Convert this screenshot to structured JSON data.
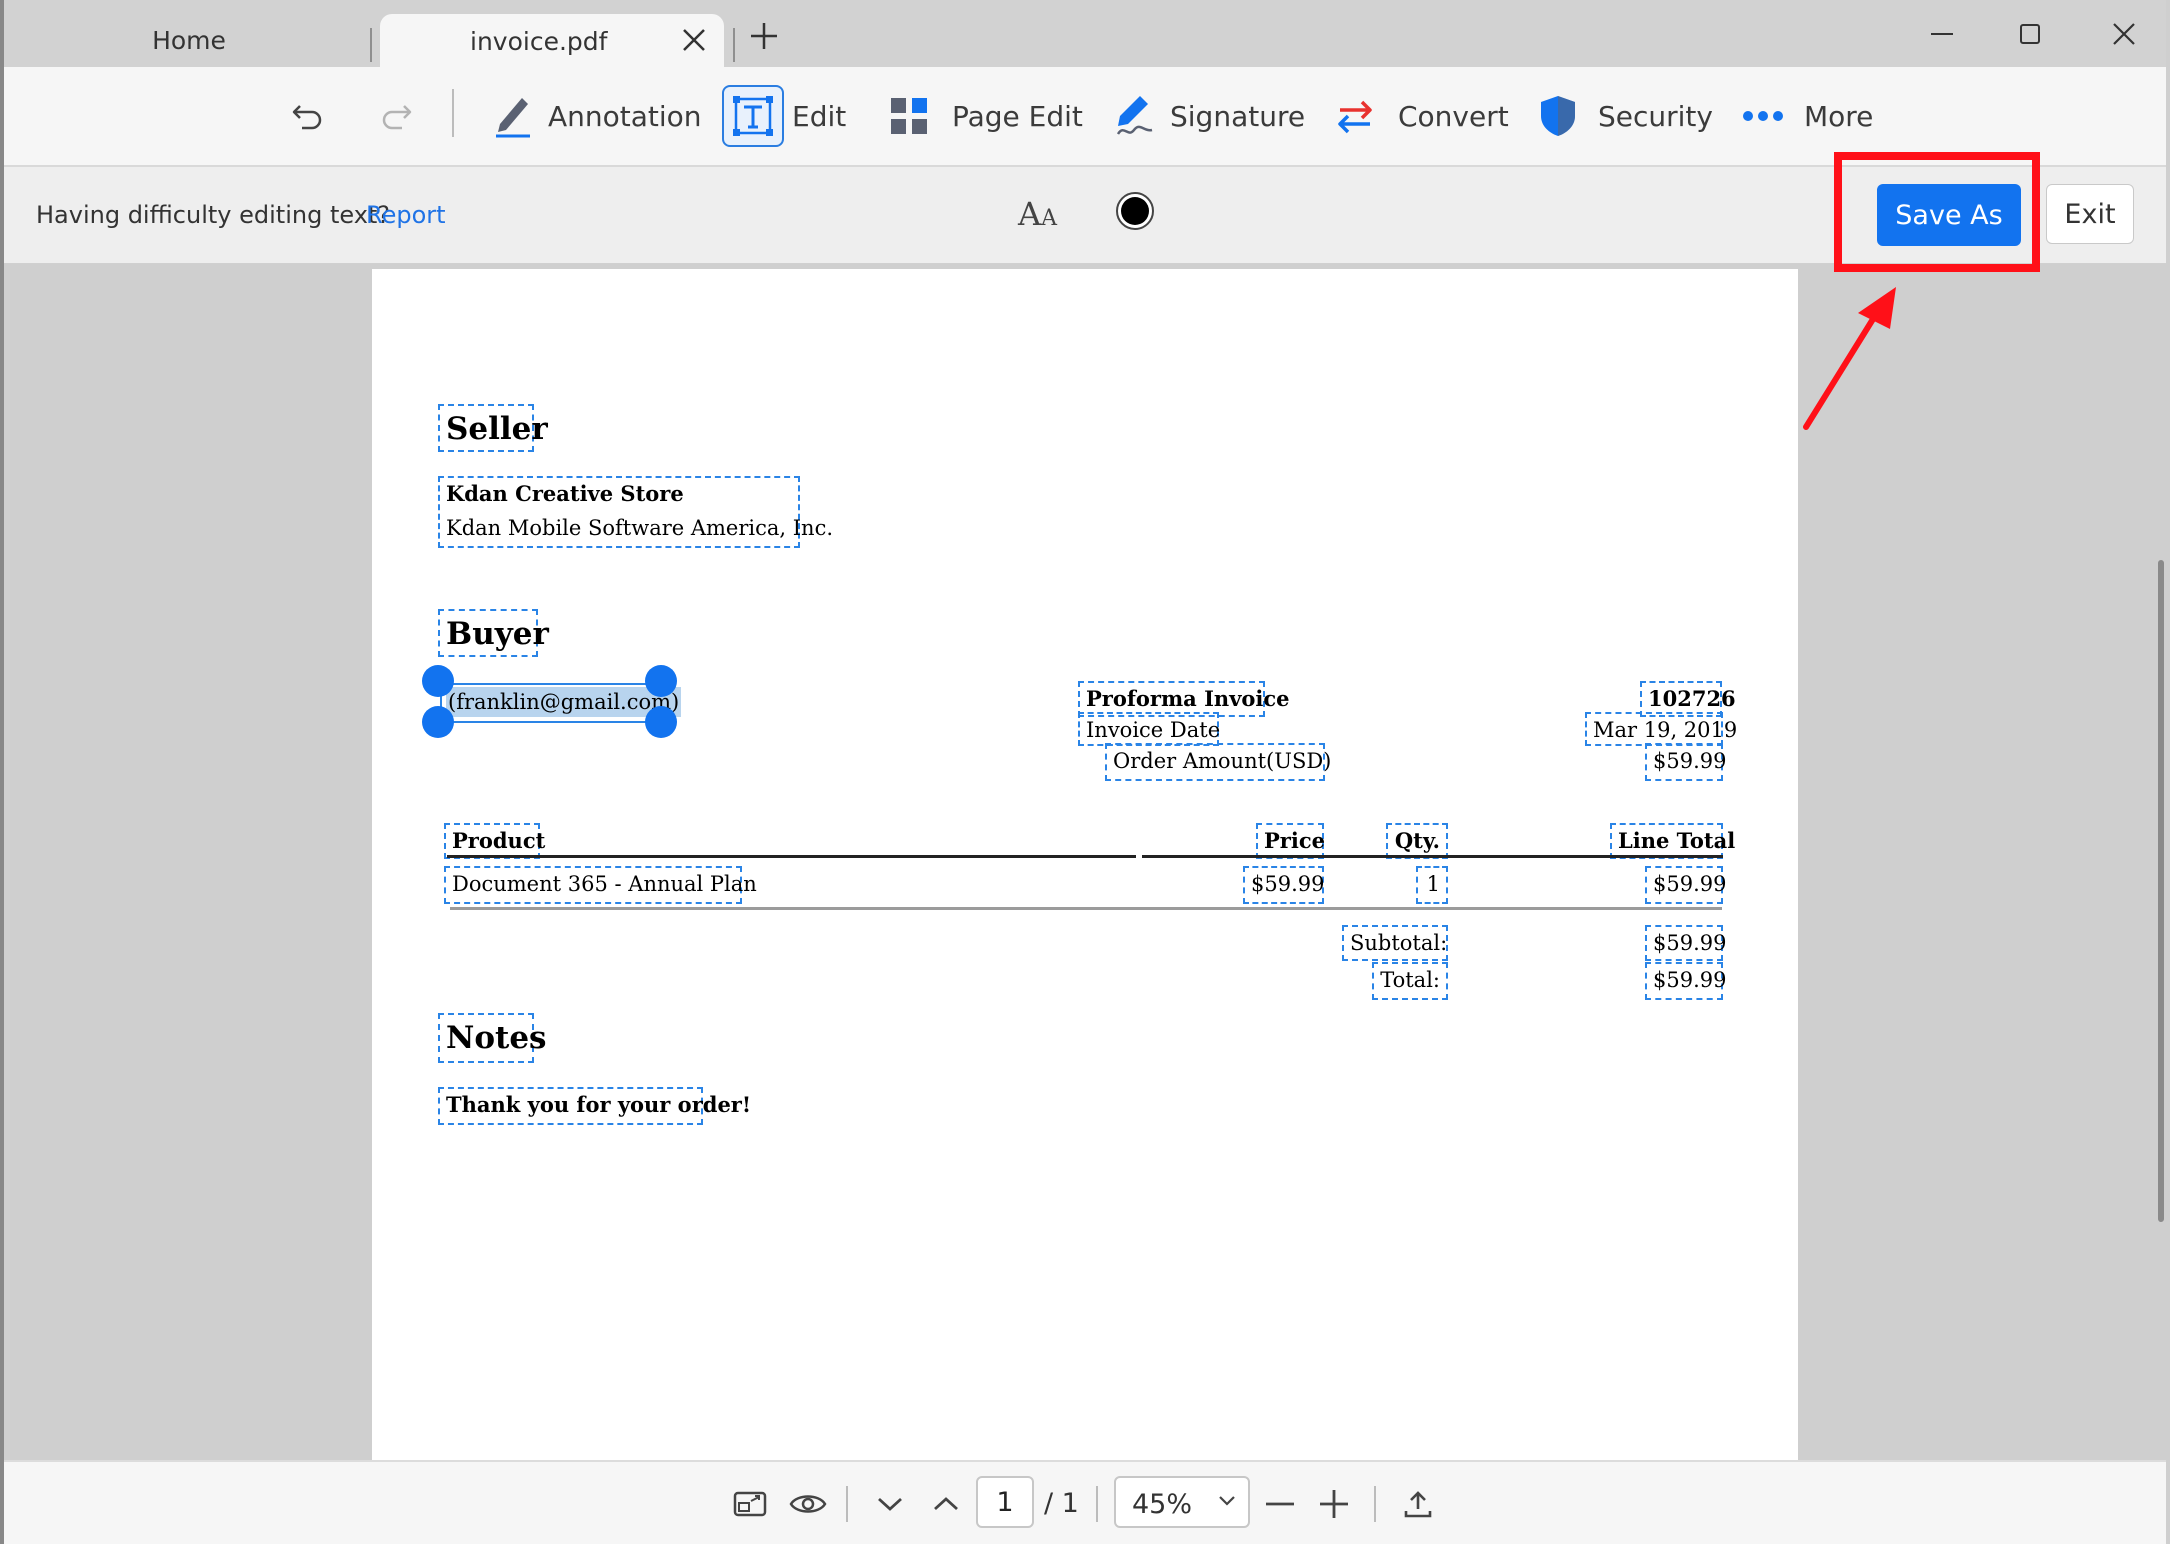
{
  "tabs": {
    "home_label": "Home",
    "active_label": "invoice.pdf"
  },
  "toolbar": {
    "annotation": "Annotation",
    "edit": "Edit",
    "page_edit": "Page Edit",
    "signature": "Signature",
    "convert": "Convert",
    "security": "Security",
    "more": "More"
  },
  "edit_bar": {
    "hint": "Having difficulty editing text?",
    "report": "Report",
    "font_size_big": "A",
    "font_size_small": "A",
    "save_as": "Save As",
    "exit": "Exit"
  },
  "invoice": {
    "seller_heading": "Seller",
    "seller_name": "Kdan Creative Store",
    "seller_company": "Kdan Mobile Software America, Inc.",
    "buyer_heading": "Buyer",
    "buyer_email": "(franklin@gmail.com)",
    "proforma_label": "Proforma Invoice",
    "invoice_number": "102726",
    "invoice_date_label": "Invoice Date",
    "invoice_date": "Mar 19, 2019",
    "order_amount_label": "Order Amount(USD)",
    "order_amount": "$59.99",
    "columns": {
      "product": "Product",
      "price": "Price",
      "qty": "Qty.",
      "line_total": "Line Total"
    },
    "items": [
      {
        "product": "Document 365 - Annual Plan",
        "price": "$59.99",
        "qty": "1",
        "line_total": "$59.99"
      }
    ],
    "subtotal_label": "Subtotal:",
    "subtotal": "$59.99",
    "total_label": "Total:",
    "total": "$59.99",
    "notes_heading": "Notes",
    "notes_text": "Thank you for your order!"
  },
  "bottom_bar": {
    "current_page": "1",
    "page_total": "/ 1",
    "zoom": "45%"
  },
  "colors": {
    "accent": "#1273ef",
    "highlight": "#ff1018",
    "text_box_border": "#2a84e6"
  }
}
